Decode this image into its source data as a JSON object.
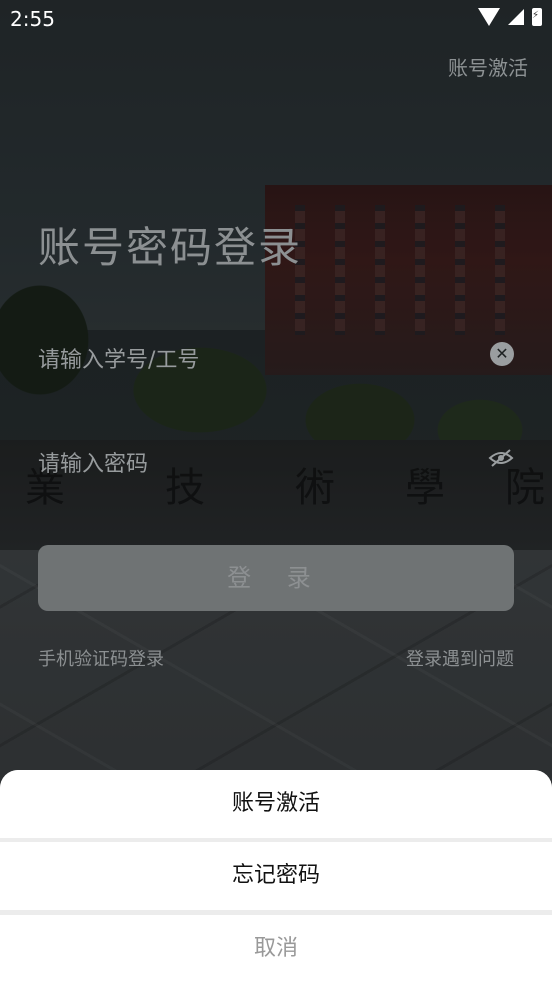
{
  "status_bar": {
    "time": "2:55"
  },
  "header": {
    "activate_link": "账号激活"
  },
  "login": {
    "title": "账号密码登录",
    "username_placeholder": "请输入学号/工号",
    "password_placeholder": "请输入密码",
    "login_button": "登 录",
    "sms_login_link": "手机验证码登录",
    "trouble_link": "登录遇到问题"
  },
  "bottom_sheet": {
    "items": [
      "账号激活",
      "忘记密码"
    ],
    "cancel": "取消"
  },
  "background_text": [
    "業",
    "技",
    "術",
    "學",
    "院"
  ]
}
